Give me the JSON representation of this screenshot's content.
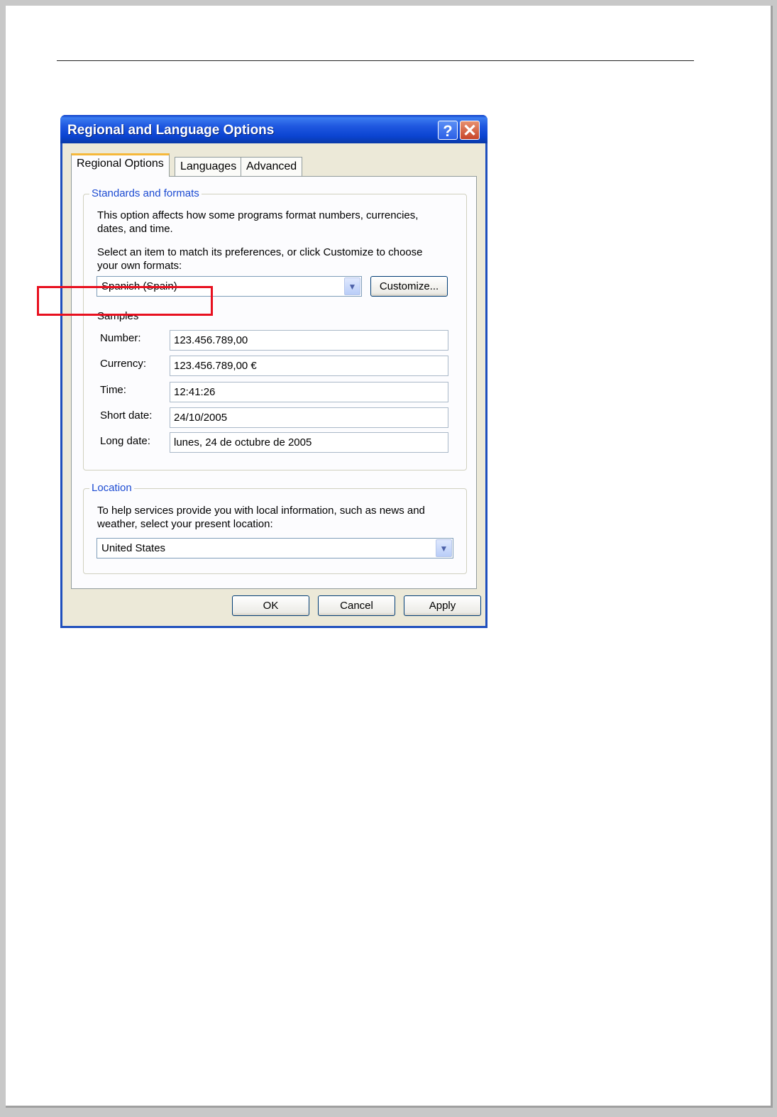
{
  "dialog": {
    "title": "Regional and Language Options",
    "help_glyph": "?",
    "close_glyph": "✕",
    "tabs": [
      {
        "label": "Regional Options"
      },
      {
        "label": "Languages"
      },
      {
        "label": "Advanced"
      }
    ],
    "standards": {
      "group_title": "Standards and formats",
      "desc1_line1": "This option affects how some programs format numbers, currencies,",
      "desc1_line2": "dates, and time.",
      "desc2_line1": "Select an item to match its preferences, or click Customize to choose",
      "desc2_line2": "your own formats:",
      "format_value": "Spanish (Spain)",
      "customize_label": "Customize...",
      "samples_label": "Samples",
      "samples": [
        {
          "label": "Number:",
          "value": "123.456.789,00"
        },
        {
          "label": "Currency:",
          "value": "123.456.789,00 €"
        },
        {
          "label": "Time:",
          "value": "12:41:26"
        },
        {
          "label": "Short date:",
          "value": "24/10/2005"
        },
        {
          "label": "Long date:",
          "value": "lunes, 24 de octubre de 2005"
        }
      ]
    },
    "location": {
      "group_title": "Location",
      "desc_line1": "To help services provide you with local information, such as news and",
      "desc_line2": "weather, select your present location:",
      "value": "United States"
    },
    "buttons": {
      "ok": "OK",
      "cancel": "Cancel",
      "apply": "Apply"
    },
    "colors": {
      "titlebar": "#0b44d1",
      "highlight": "#e8101f",
      "group_title": "#1c4bd2"
    }
  }
}
